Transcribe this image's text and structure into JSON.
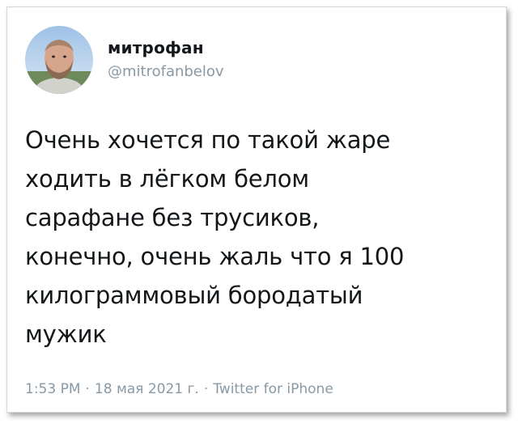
{
  "tweet": {
    "display_name": "митрофан",
    "handle": "@mitrofanbelov",
    "text": "Очень хочется по такой жаре\nходить в лёгком белом\nсарафане без трусиков,\nконечно, очень жаль что я 100\nкилограммовый бородатый\nмужик",
    "time": "1:53 PM",
    "separator": "·",
    "date": "18 мая 2021 г.",
    "source": "Twitter for iPhone"
  },
  "colors": {
    "text": "#14171a",
    "secondary": "#8899a6",
    "background": "#ffffff"
  }
}
